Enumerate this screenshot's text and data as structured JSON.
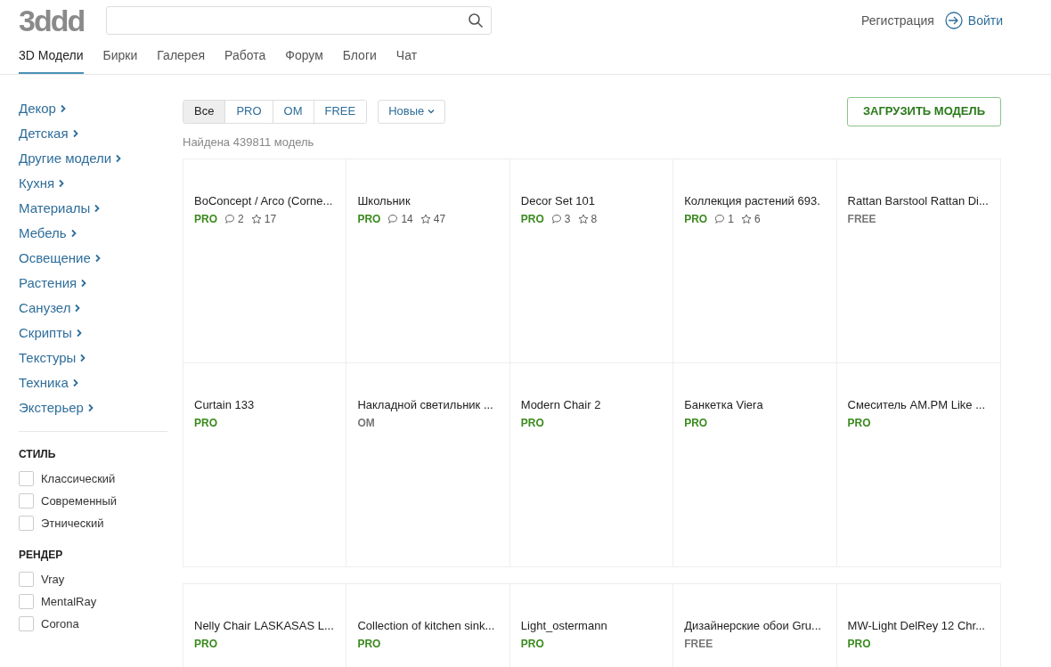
{
  "logo": "3ddd",
  "auth": {
    "register": "Регистрация",
    "login": "Войти"
  },
  "nav": [
    {
      "label": "3D Модели",
      "selected": true
    },
    {
      "label": "Бирки",
      "selected": false
    },
    {
      "label": "Галерея",
      "selected": false
    },
    {
      "label": "Работа",
      "selected": false
    },
    {
      "label": "Форум",
      "selected": false
    },
    {
      "label": "Блоги",
      "selected": false
    },
    {
      "label": "Чат",
      "selected": false
    }
  ],
  "categories": [
    "Декор",
    "Детская",
    "Другие модели",
    "Кухня",
    "Материалы",
    "Мебель",
    "Освещение",
    "Растения",
    "Санузел",
    "Скрипты",
    "Текстуры",
    "Техника",
    "Экстерьер"
  ],
  "filters": [
    {
      "title": "СТИЛЬ",
      "options": [
        {
          "label": "Классический",
          "checked": false
        },
        {
          "label": "Современный",
          "checked": false
        },
        {
          "label": "Этнический",
          "checked": false
        }
      ]
    },
    {
      "title": "РЕНДЕР",
      "options": [
        {
          "label": "Vray",
          "checked": false
        },
        {
          "label": "MentalRay",
          "checked": false
        },
        {
          "label": "Corona",
          "checked": false
        }
      ]
    }
  ],
  "segments": [
    {
      "label": "Все",
      "selected": true
    },
    {
      "label": "PRO",
      "selected": false
    },
    {
      "label": "OM",
      "selected": false
    },
    {
      "label": "FREE",
      "selected": false
    }
  ],
  "sort": {
    "label": "Новые"
  },
  "upload_button": "ЗАГРУЗИТЬ МОДЕЛЬ",
  "found": "Найдена 439811 модель",
  "rows": [
    [
      {
        "title": "BoConcept / Arco (Corne...",
        "kind": "pro",
        "tag": "PRO",
        "comments": "2",
        "stars_count": "17"
      },
      {
        "title": "Школьник",
        "kind": "pro",
        "tag": "PRO",
        "comments": "14",
        "stars_count": "47"
      },
      {
        "title": "Decor Set 101",
        "kind": "pro",
        "tag": "PRO",
        "comments": "3",
        "stars_count": "8"
      },
      {
        "title": "Коллекция растений 693.",
        "kind": "pro",
        "tag": "PRO",
        "comments": "1",
        "stars_count": "6"
      },
      {
        "title": "Rattan Barstool Rattan Di...",
        "kind": "free",
        "tag": "FREE"
      }
    ],
    [
      {
        "title": "Curtain 133",
        "kind": "pro",
        "tag": "PRO"
      },
      {
        "title": "Накладной светильник ...",
        "kind": "om",
        "tag": "OM"
      },
      {
        "title": "Modern Chair 2",
        "kind": "pro",
        "tag": "PRO"
      },
      {
        "title": "Банкетка Viera",
        "kind": "pro",
        "tag": "PRO"
      },
      {
        "title": "Смеситель AM.PM Like ...",
        "kind": "pro",
        "tag": "PRO"
      }
    ],
    [
      {
        "title": "Nelly Chair LASKASAS L...",
        "kind": "pro",
        "tag": "PRO"
      },
      {
        "title": "Collection of kitchen sink...",
        "kind": "pro",
        "tag": "PRO"
      },
      {
        "title": "Light_ostermann",
        "kind": "pro",
        "tag": "PRO"
      },
      {
        "title": "Дизайнерские обои Gru...",
        "kind": "free",
        "tag": "FREE"
      },
      {
        "title": "MW-Light DelRey 12 Chr...",
        "kind": "pro",
        "tag": "PRO"
      }
    ]
  ]
}
